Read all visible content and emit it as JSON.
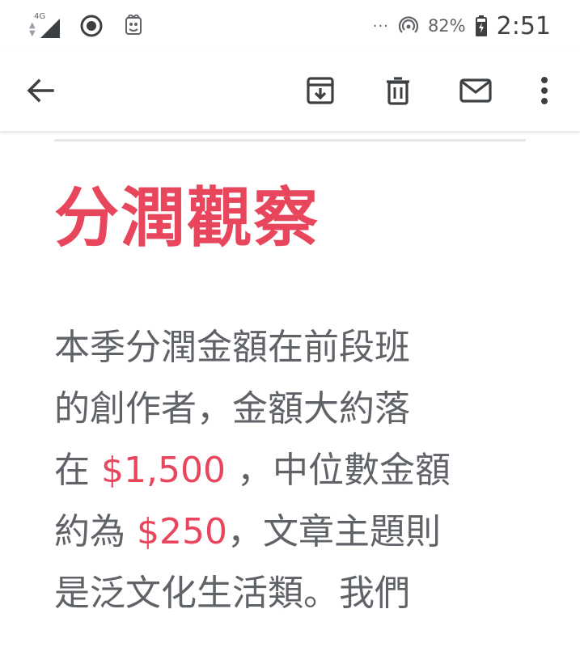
{
  "status_bar": {
    "network_type": "4G",
    "overflow": "···",
    "battery_percent": "82%",
    "time": "2:51",
    "icons": [
      "signal-icon",
      "media-record-icon",
      "app-notification-icon",
      "hotspot-icon",
      "battery-charging-icon"
    ]
  },
  "toolbar": {
    "icons": [
      "back-arrow-icon",
      "archive-icon",
      "trash-icon",
      "mail-icon",
      "more-vert-icon"
    ]
  },
  "article": {
    "heading": "分潤觀察",
    "paragraph": {
      "line1": "本季分潤金額在前段班",
      "line2": "的創作者，金額大約落",
      "line3_pre": "在 ",
      "amount_high": "$1,500",
      "line3_post": " ，中位數金額",
      "line4_pre": "約為 ",
      "amount_median": "$250",
      "line4_post": "，文章主題則",
      "line5": "是泛文化生活類。我們"
    }
  },
  "colors": {
    "accent": "#e8465c",
    "text": "#5f6368",
    "icon": "#3c4043"
  }
}
